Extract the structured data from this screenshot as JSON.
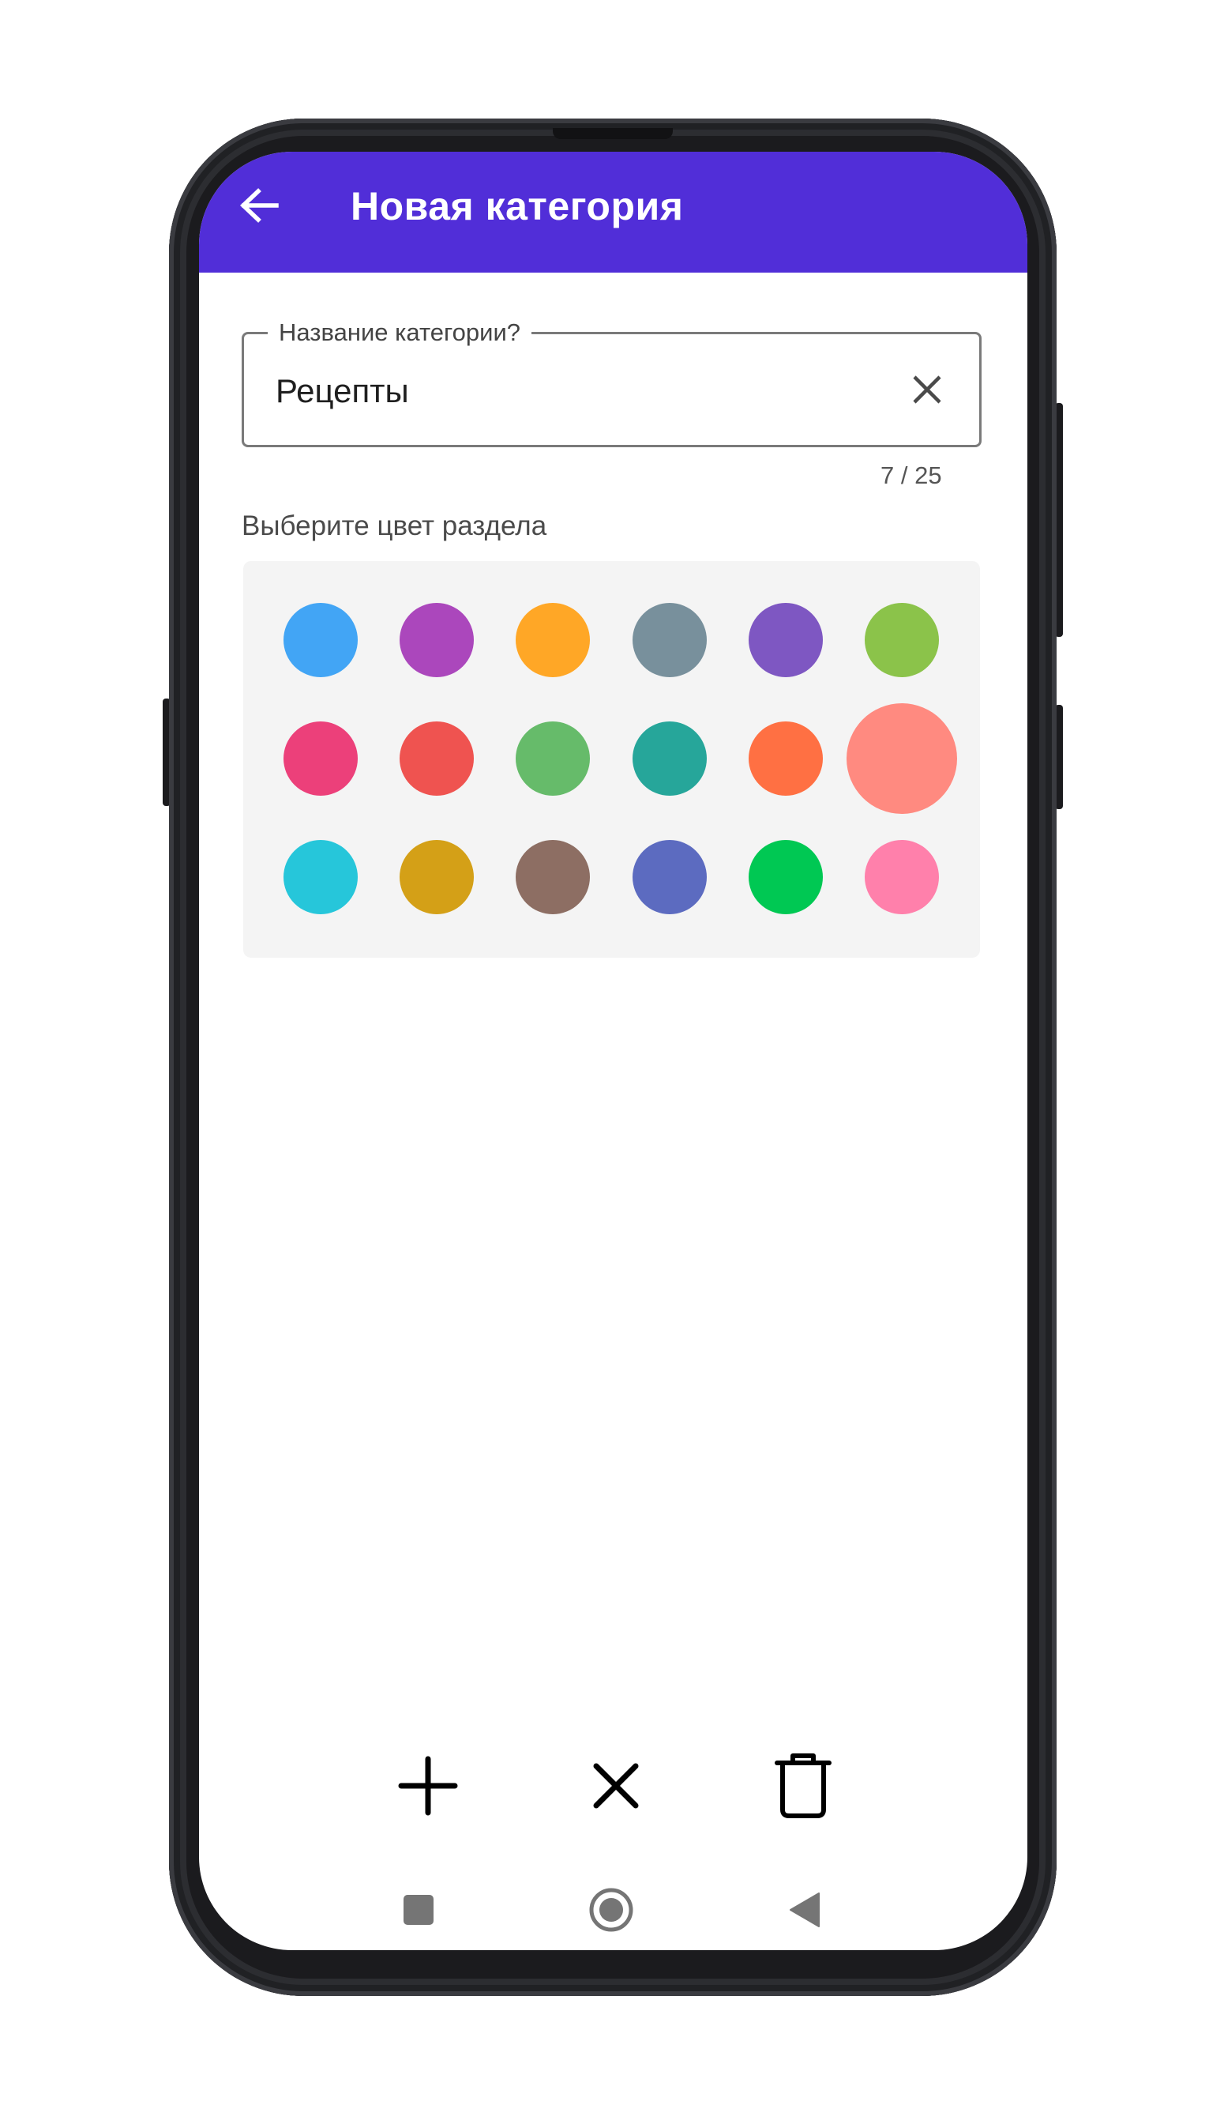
{
  "app_bar": {
    "title": "Новая категория",
    "back_icon": "arrow-left-icon",
    "background": "#512ed8"
  },
  "name_field": {
    "label": "Название категории?",
    "value": "Рецепты",
    "counter": "7 / 25",
    "clear_icon": "close-icon"
  },
  "palette": {
    "label": "Выберите цвет раздела",
    "selected_color": "#ff8a80",
    "colors": [
      "#42a5f5",
      "#ab47bc",
      "#ffa726",
      "#78909c",
      "#7e57c2",
      "#8bc34a",
      "#ec407a",
      "#ef5350",
      "#66bb6a",
      "#26a69a",
      "#ff7043",
      "#ff8a80",
      "#26c6da",
      "#d4a017",
      "#8d6e63",
      "#5c6bc0",
      "#00c853",
      "#ff80ab"
    ]
  },
  "actions": {
    "add_icon": "plus-icon",
    "cancel_icon": "close-icon",
    "delete_icon": "trash-icon"
  },
  "system_nav": {
    "recents_icon": "square-icon",
    "home_icon": "circle-icon",
    "back_icon": "triangle-back-icon"
  }
}
